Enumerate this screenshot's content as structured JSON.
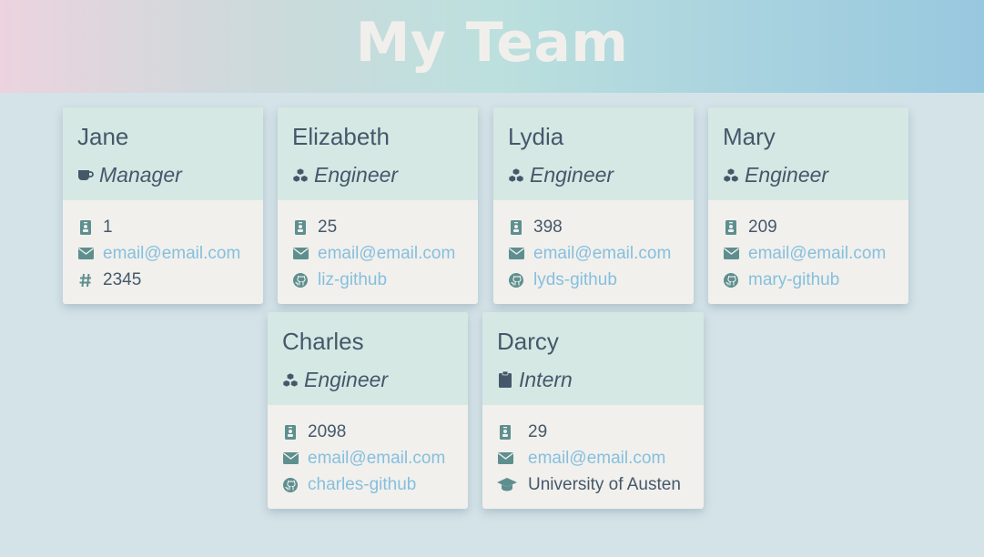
{
  "header": {
    "title": "My Team"
  },
  "cards": [
    {
      "name": "Jane",
      "role": "Manager",
      "role_icon": "coffee-icon",
      "id": "1",
      "email": "email@email.com",
      "extra_icon": "hashtag-icon",
      "extra": "2345",
      "extra_is_link": false
    },
    {
      "name": "Elizabeth",
      "role": "Engineer",
      "role_icon": "cubes-icon",
      "id": "25",
      "email": "email@email.com",
      "extra_icon": "github-icon",
      "extra": "liz-github",
      "extra_is_link": true
    },
    {
      "name": "Lydia",
      "role": "Engineer",
      "role_icon": "cubes-icon",
      "id": "398",
      "email": "email@email.com",
      "extra_icon": "github-icon",
      "extra": "lyds-github",
      "extra_is_link": true
    },
    {
      "name": "Mary",
      "role": "Engineer",
      "role_icon": "cubes-icon",
      "id": "209",
      "email": "email@email.com",
      "extra_icon": "github-icon",
      "extra": "mary-github",
      "extra_is_link": true
    },
    {
      "name": "Charles",
      "role": "Engineer",
      "role_icon": "cubes-icon",
      "id": "2098",
      "email": "email@email.com",
      "extra_icon": "github-icon",
      "extra": "charles-github",
      "extra_is_link": true
    },
    {
      "name": "Darcy",
      "role": "Intern",
      "role_icon": "clipboard-icon",
      "id": "29",
      "email": "email@email.com",
      "extra_icon": "graduation-cap-icon",
      "extra": "University of Austen",
      "extra_is_link": false
    }
  ],
  "colors": {
    "accent_link": "#86bfdd",
    "icon": "#5e8f8f",
    "text": "#45586a"
  }
}
